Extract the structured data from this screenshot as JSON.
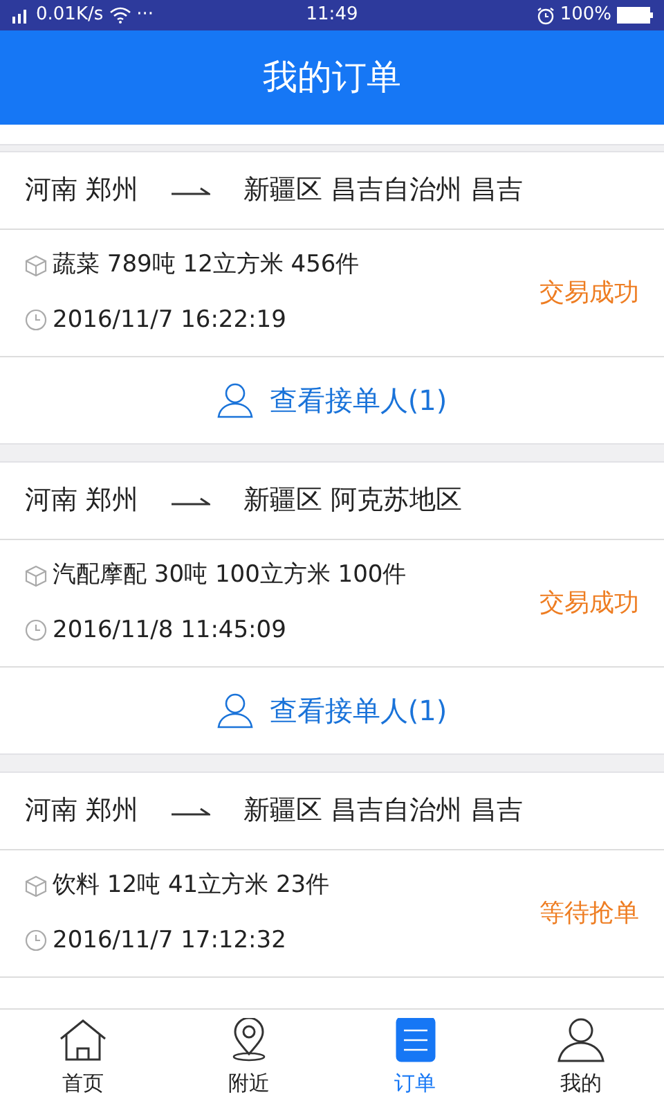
{
  "status_bar": {
    "speed": "0.01K/s",
    "more": "···",
    "time": "11:49",
    "battery": "100%"
  },
  "header": {
    "title": "我的订单"
  },
  "orders": [
    {
      "from": "河南 郑州",
      "to": "新疆区 昌吉自治州 昌吉",
      "goods": "蔬菜 789吨 12立方米 456件",
      "time": "2016/11/7 16:22:19",
      "status": "交易成功",
      "action": "查看接单人(1)"
    },
    {
      "from": "河南 郑州",
      "to": "新疆区 阿克苏地区",
      "goods": "汽配摩配 30吨 100立方米 100件",
      "time": "2016/11/8 11:45:09",
      "status": "交易成功",
      "action": "查看接单人(1)"
    },
    {
      "from": "河南 郑州",
      "to": "新疆区 昌吉自治州 昌吉",
      "goods": "饮料 12吨 41立方米 23件",
      "time": "2016/11/7 17:12:32",
      "status": "等待抢单"
    }
  ],
  "tab_bar": [
    {
      "kind": "home",
      "label": "首页",
      "selected": false
    },
    {
      "kind": "pin",
      "label": "附近",
      "selected": false
    },
    {
      "kind": "list",
      "label": "订单",
      "selected": true
    },
    {
      "kind": "person",
      "label": "我的",
      "selected": false
    }
  ]
}
